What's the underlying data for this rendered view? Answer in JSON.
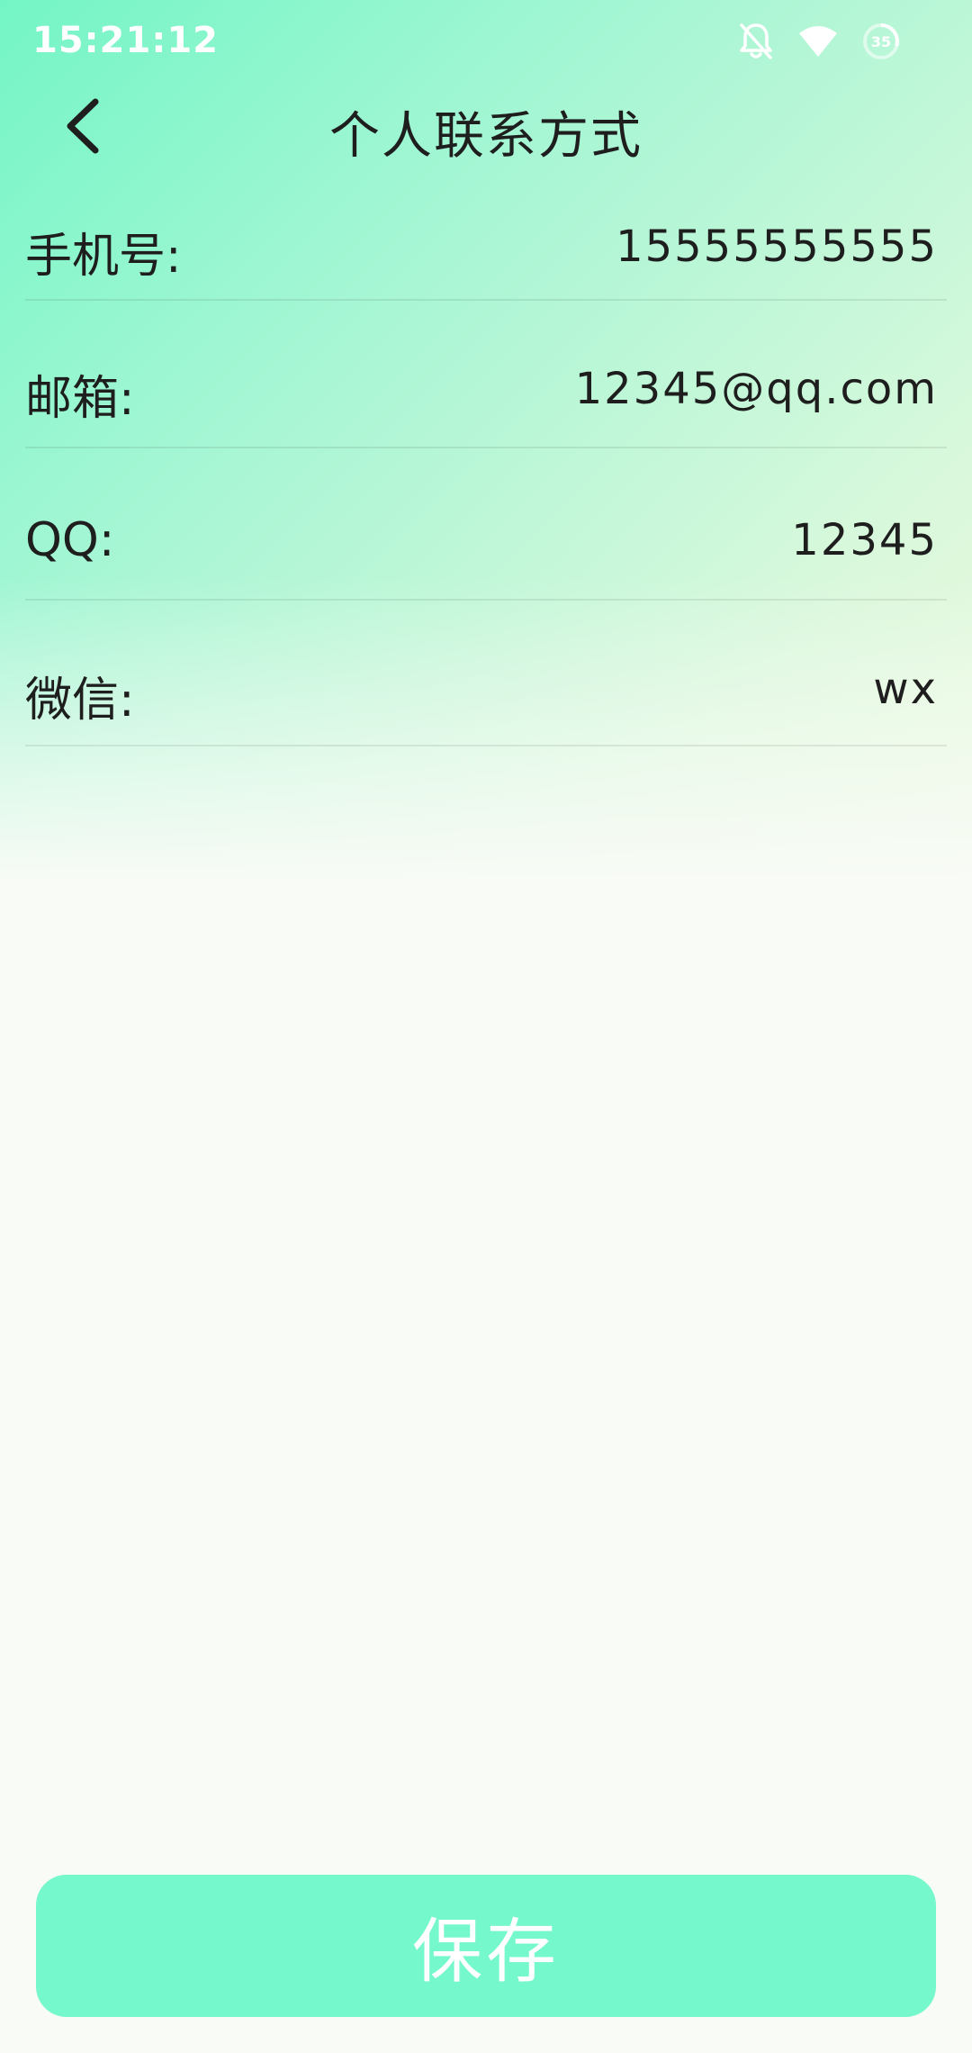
{
  "status_bar": {
    "time": "15:21:12",
    "battery_level": "35",
    "icons": [
      "bell-off-icon",
      "wifi-icon",
      "battery-icon"
    ]
  },
  "header": {
    "title": "个人联系方式",
    "back_icon": "chevron-left-icon"
  },
  "form": {
    "fields": [
      {
        "label": "手机号:",
        "value": "15555555555"
      },
      {
        "label": "邮箱:",
        "value": "12345@qq.com"
      },
      {
        "label": "QQ:",
        "value": "12345"
      },
      {
        "label": "微信:",
        "value": "wx"
      }
    ]
  },
  "actions": {
    "save_label": "保存"
  },
  "colors": {
    "accent": "#75f8cb",
    "gradient_top_left": "#74f5c6",
    "gradient_top_right": "#f6fbe0",
    "background": "#f8fbf6",
    "text": "#1e1e1e"
  }
}
